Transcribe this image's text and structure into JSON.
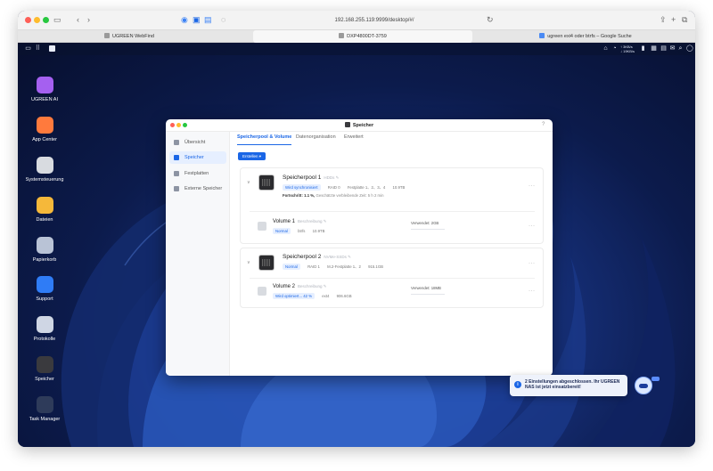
{
  "browser": {
    "url": "192.168.255.119:9999/desktop/#/",
    "tabs": [
      {
        "label": "UGREEN WebFind"
      },
      {
        "label": "DXP4800DT-3759"
      },
      {
        "label": "ugreen exi4 oder btrfs – Google Suche"
      }
    ]
  },
  "topbar": {
    "speed_up": "↑ 3KB/s",
    "speed_down": "↓ 19KB/s"
  },
  "desktop_apps": [
    {
      "label": "UGREEN AI",
      "color": "#a560f0"
    },
    {
      "label": "App Center",
      "color": "#ff7a3d"
    },
    {
      "label": "Systemsteuerung",
      "color": "#d8dbe0"
    },
    {
      "label": "Dateien",
      "color": "#f5b83a"
    },
    {
      "label": "Papierkorb",
      "color": "#b9c3d6"
    },
    {
      "label": "Support",
      "color": "#2f7cf6"
    },
    {
      "label": "Protokolle",
      "color": "#cfd6e4"
    },
    {
      "label": "Speicher",
      "color": "#3a3a3e"
    },
    {
      "label": "Task Manager",
      "color": "#2e3b5a"
    }
  ],
  "window": {
    "title": "Speicher",
    "help": "?",
    "sidebar": [
      {
        "label": "Übersicht"
      },
      {
        "label": "Speicher"
      },
      {
        "label": "Festplatten"
      },
      {
        "label": "Externe Speicher"
      }
    ],
    "tabs": [
      {
        "label": "Speicherpool & Volume"
      },
      {
        "label": "Datenorganisation"
      },
      {
        "label": "Erweitert"
      }
    ],
    "create_label": "Erstellen ▾",
    "pools": [
      {
        "name": "Speicherpool 1",
        "subtitle": "HDDs ✎",
        "badge": "Wird synchronisiert",
        "raid": "RAID 0",
        "disks": "Festplatte 1、2、3、4",
        "capacity": "10.9TB",
        "progress_label": "Fortschritt: 1.1 %,",
        "progress_remaining": "Geschätzte verbleibende Zeit: 5 h 2 min",
        "volume": {
          "name": "Volume 1",
          "subtitle": "Beschreibung ✎",
          "status": "Normal",
          "fs": "btrfs",
          "size": "10.9TB",
          "used": "Verwendet: 2GB"
        }
      },
      {
        "name": "Speicherpool 2",
        "subtitle": "NVMe-SSDs ✎",
        "badge": "Normal",
        "raid": "RAID 1",
        "disks": "M.2-Festplatte 1、2",
        "capacity": "915.1GB",
        "volume": {
          "name": "Volume 2",
          "subtitle": "Beschreibung ✎",
          "status": "Wird optimiert... 42 %",
          "fs": "ext4",
          "size": "906.6GB",
          "used": "Verwendet: 18MB"
        }
      }
    ]
  },
  "notification": {
    "text": "2 Einstellungen abgeschlossen. Ihr UGREEN NAS ist jetzt einsatzbereit!"
  }
}
